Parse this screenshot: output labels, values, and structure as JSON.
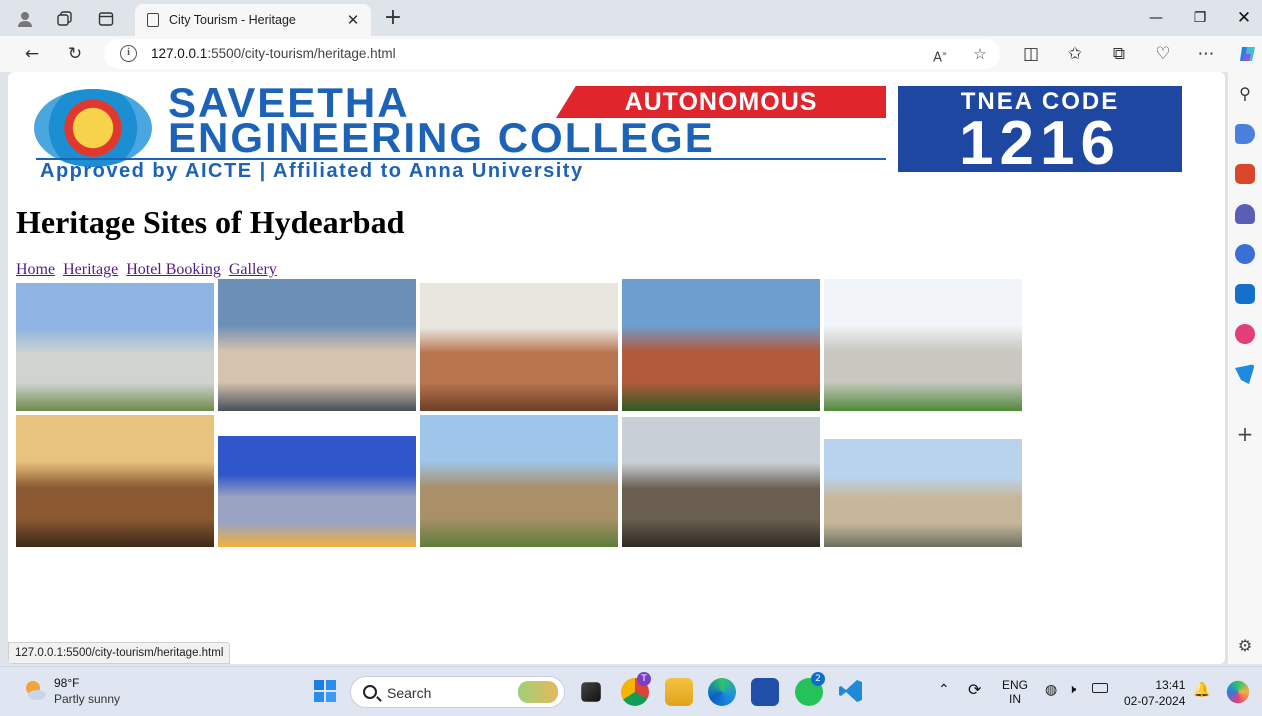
{
  "browser": {
    "tab_title": "City Tourism - Heritage",
    "url_host": "127.0.0.1",
    "url_path": ":5500/city-tourism/heritage.html",
    "status_url": "127.0.0.1:5500/city-tourism/heritage.html"
  },
  "banner": {
    "line1": "SAVEETHA",
    "autonomous": "AUTONOMOUS",
    "line2": "ENGINEERING COLLEGE",
    "subtitle": "Approved by AICTE  |  Affiliated to Anna University",
    "tnea_label": "TNEA CODE",
    "tnea_code": "1216"
  },
  "page": {
    "heading": "Heritage Sites of Hydearbad",
    "nav": [
      "Home",
      "Heritage",
      "Hotel Booking",
      "Gallery"
    ]
  },
  "gallery": [
    {
      "name": "qutb-shahi-tomb-photo",
      "colors": [
        "#8db4e2",
        "#cfd4cf",
        "#6f8a4a"
      ]
    },
    {
      "name": "baradari-pavilion-photo",
      "colors": [
        "#6c8fb8",
        "#d6c3ad",
        "#47505a"
      ]
    },
    {
      "name": "stone-pavilion-photo",
      "colors": [
        "#e9e6e0",
        "#b8744c",
        "#6c3f28"
      ]
    },
    {
      "name": "safdarjung-tomb-photo",
      "colors": [
        "#6e9ed0",
        "#b25a3c",
        "#2f5b24"
      ]
    },
    {
      "name": "chowmahalla-palace-photo",
      "colors": [
        "#f1f4f8",
        "#c8c8c0",
        "#4f8a3a"
      ]
    },
    {
      "name": "domed-tomb-sunset-photo",
      "colors": [
        "#e7c37e",
        "#8b5a33",
        "#3d2716"
      ]
    },
    {
      "name": "charminar-night-photo",
      "colors": [
        "#2f57c9",
        "#9aa3c2",
        "#f2b13e"
      ]
    },
    {
      "name": "mosque-minarets-photo",
      "colors": [
        "#9ec5ea",
        "#a99069",
        "#5e7d3a"
      ]
    },
    {
      "name": "mecca-masjid-photo",
      "colors": [
        "#c9cfd6",
        "#6b5f52",
        "#2e2a25"
      ]
    },
    {
      "name": "charminar-day-photo",
      "colors": [
        "#b9d3ee",
        "#c7b79a",
        "#6a6f5f"
      ]
    }
  ],
  "taskbar": {
    "temp": "98°F",
    "weather": "Partly sunny",
    "search": "Search",
    "lang1": "ENG",
    "lang2": "IN",
    "time": "13:41",
    "date": "02-07-2024",
    "chrome_badge": "T",
    "whatsapp_badge": "2"
  }
}
